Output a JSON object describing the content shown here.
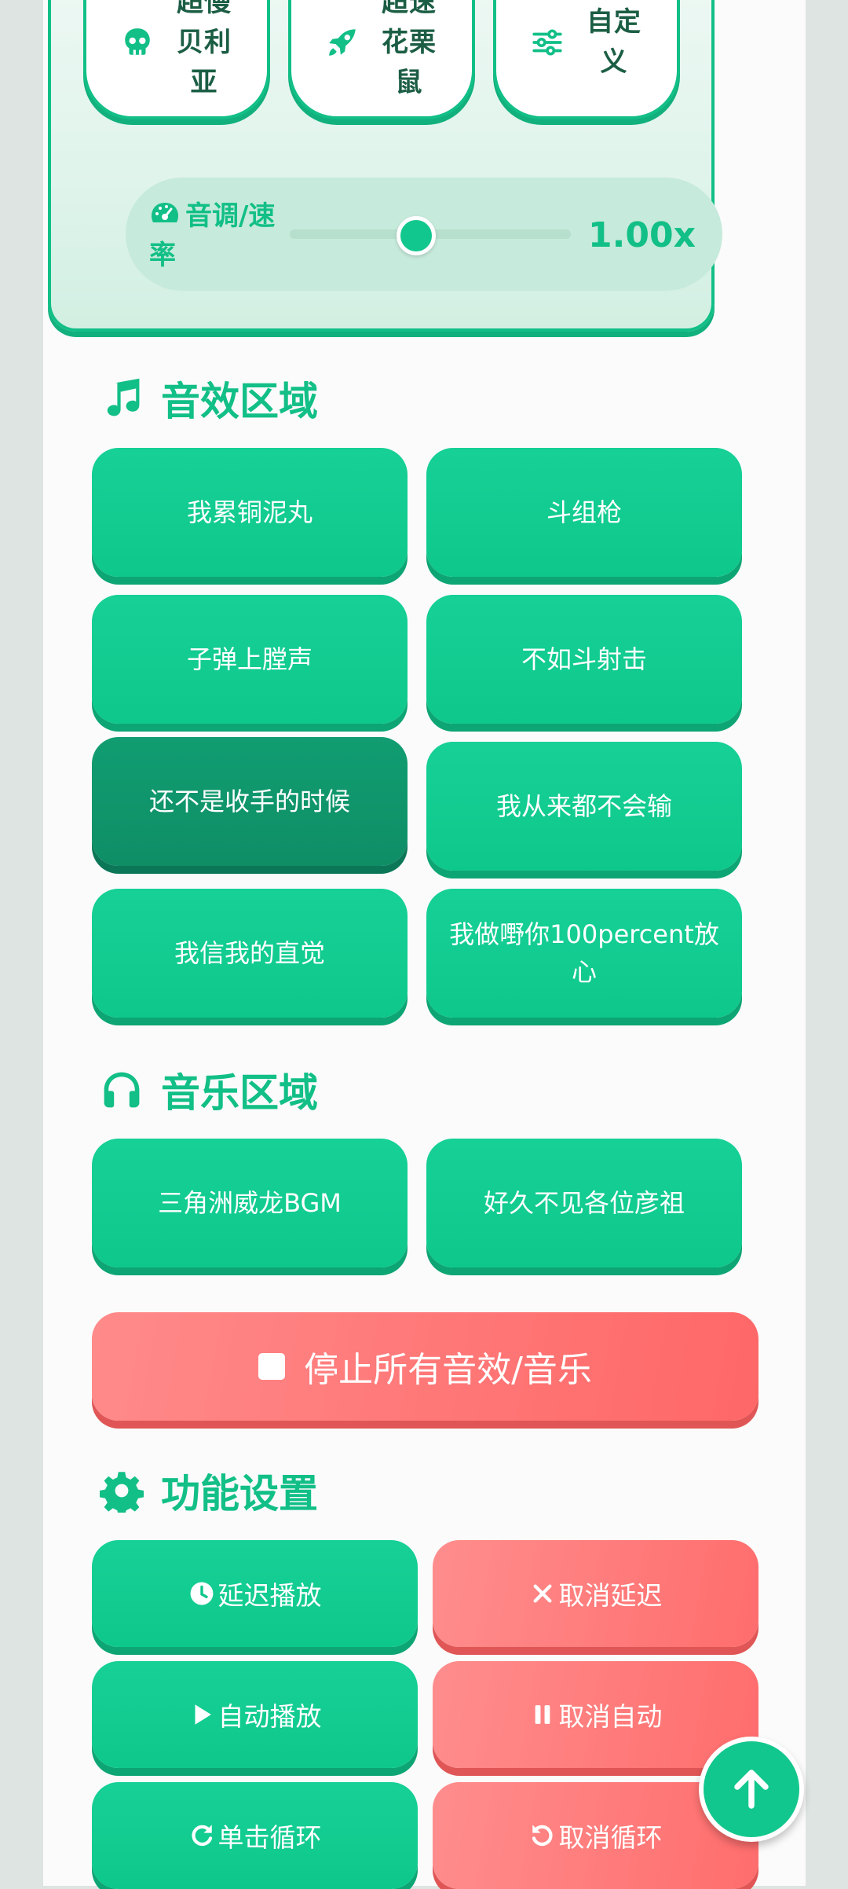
{
  "voice": {
    "presets": [
      {
        "label": "超慢贝利亚",
        "icon": "skull-icon"
      },
      {
        "label": "超速花栗鼠",
        "icon": "rocket-icon"
      },
      {
        "label": "自定义",
        "icon": "sliders-icon"
      }
    ],
    "pitch": {
      "label": "音调/速率",
      "icon": "gauge-icon",
      "value_text": "1.00x",
      "slider_fraction": 0.45
    }
  },
  "sfx": {
    "title": "音效区域",
    "icon": "music-note-icon",
    "buttons": [
      "我累铜泥丸",
      "斗组枪",
      "子弹上膛声",
      "不如斗射击",
      "还不是收手的时候",
      "我从来都不会输",
      "我信我的直觉",
      "我做嘢你100percent放心"
    ],
    "active_index": 4
  },
  "music": {
    "title": "音乐区域",
    "icon": "headphones-icon",
    "buttons": [
      "三角洲威龙BGM",
      "好久不见各位彦祖"
    ]
  },
  "stop": {
    "label": "停止所有音效/音乐",
    "icon": "stop-square-icon"
  },
  "settings": {
    "title": "功能设置",
    "icon": "gear-icon",
    "buttons": [
      {
        "label": "延迟播放",
        "icon": "clock-icon"
      },
      {
        "label": "取消延迟",
        "icon": "close-icon"
      },
      {
        "label": "自动播放",
        "icon": "play-icon"
      },
      {
        "label": "取消自动",
        "icon": "pause-icon"
      },
      {
        "label": "单击循环",
        "icon": "redo-icon"
      },
      {
        "label": "取消循环",
        "icon": "undo-icon"
      }
    ]
  },
  "fab": {
    "icon": "arrow-up-icon"
  },
  "colors": {
    "accent": "#12bf86",
    "button_green": "#0ec88b",
    "button_active": "#0f8e66",
    "danger": "#ff6b6b",
    "panel_bg": "#dff4eb"
  }
}
